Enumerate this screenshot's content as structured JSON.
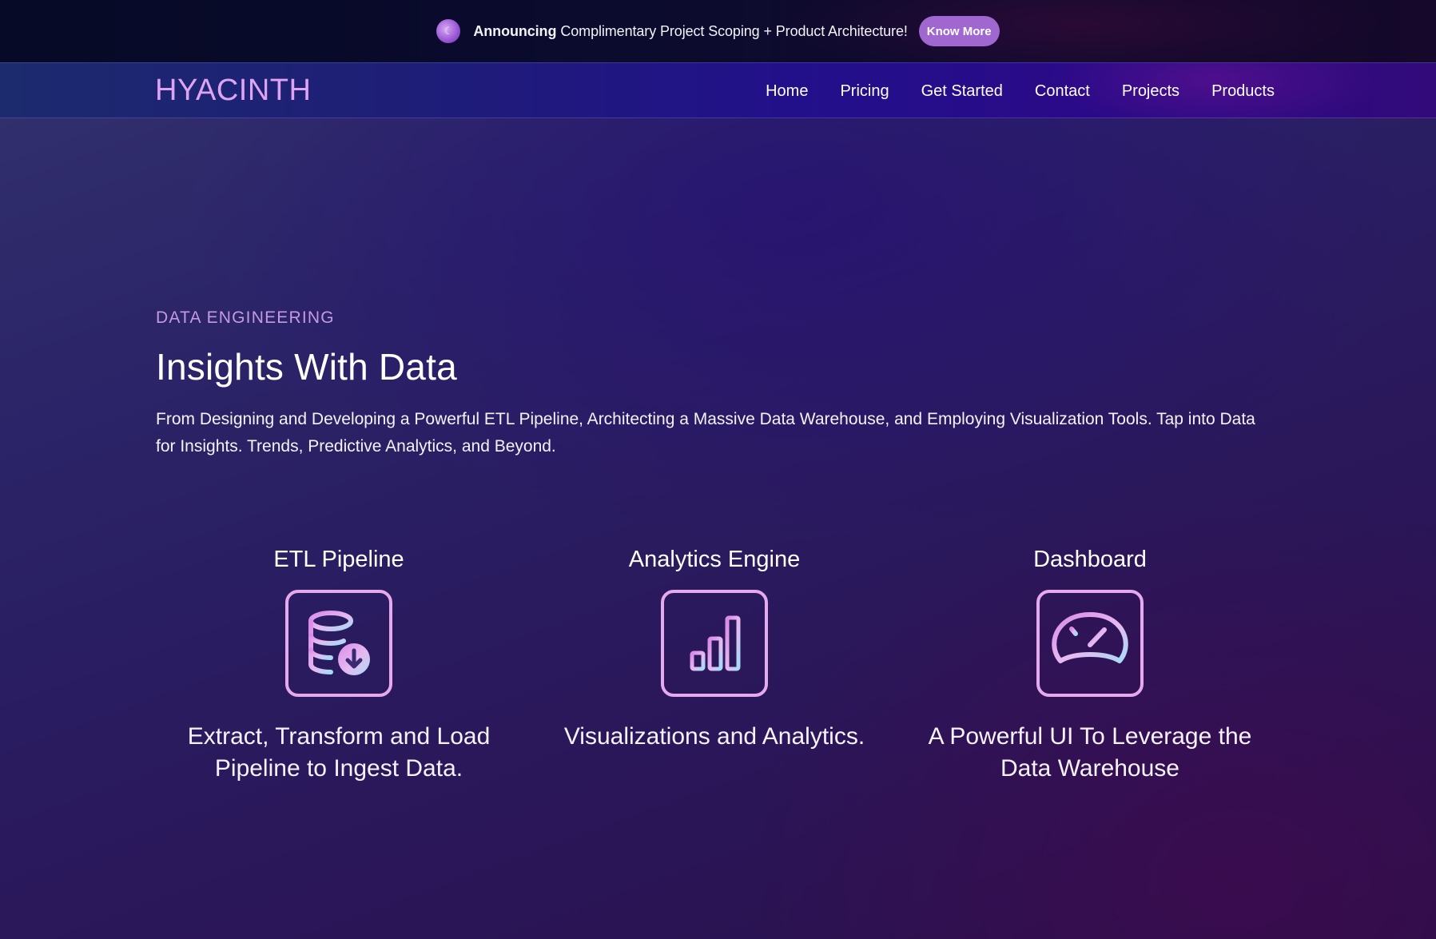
{
  "announcement": {
    "icon": "moon-orb-icon",
    "bold": "Announcing",
    "text": "Complimentary Project Scoping + Product Architecture!",
    "button": "Know More"
  },
  "header": {
    "logo": "HYACINTH",
    "nav": [
      "Home",
      "Pricing",
      "Get Started",
      "Contact",
      "Projects",
      "Products"
    ]
  },
  "hero": {
    "eyebrow": "DATA ENGINEERING",
    "title": "Insights With Data",
    "description": "From Designing and Developing a Powerful ETL Pipeline, Architecting a Massive Data Warehouse, and Employing Visualization Tools. Tap into Data for Insights. Trends, Predictive Analytics, and Beyond."
  },
  "features": [
    {
      "title": "ETL Pipeline",
      "icon": "database-download-icon",
      "description": "Extract, Transform and Load Pipeline to Ingest Data."
    },
    {
      "title": "Analytics Engine",
      "icon": "bar-chart-icon",
      "description": "Visualizations and Analytics."
    },
    {
      "title": "Dashboard",
      "icon": "speedometer-icon",
      "description": "A Powerful UI To Leverage the Data Warehouse"
    }
  ],
  "colors": {
    "accent": "#dea3f2",
    "button": "#9f67cf",
    "icon_gradient_start": "#d88ae6",
    "icon_gradient_end": "#a9d9f5"
  }
}
